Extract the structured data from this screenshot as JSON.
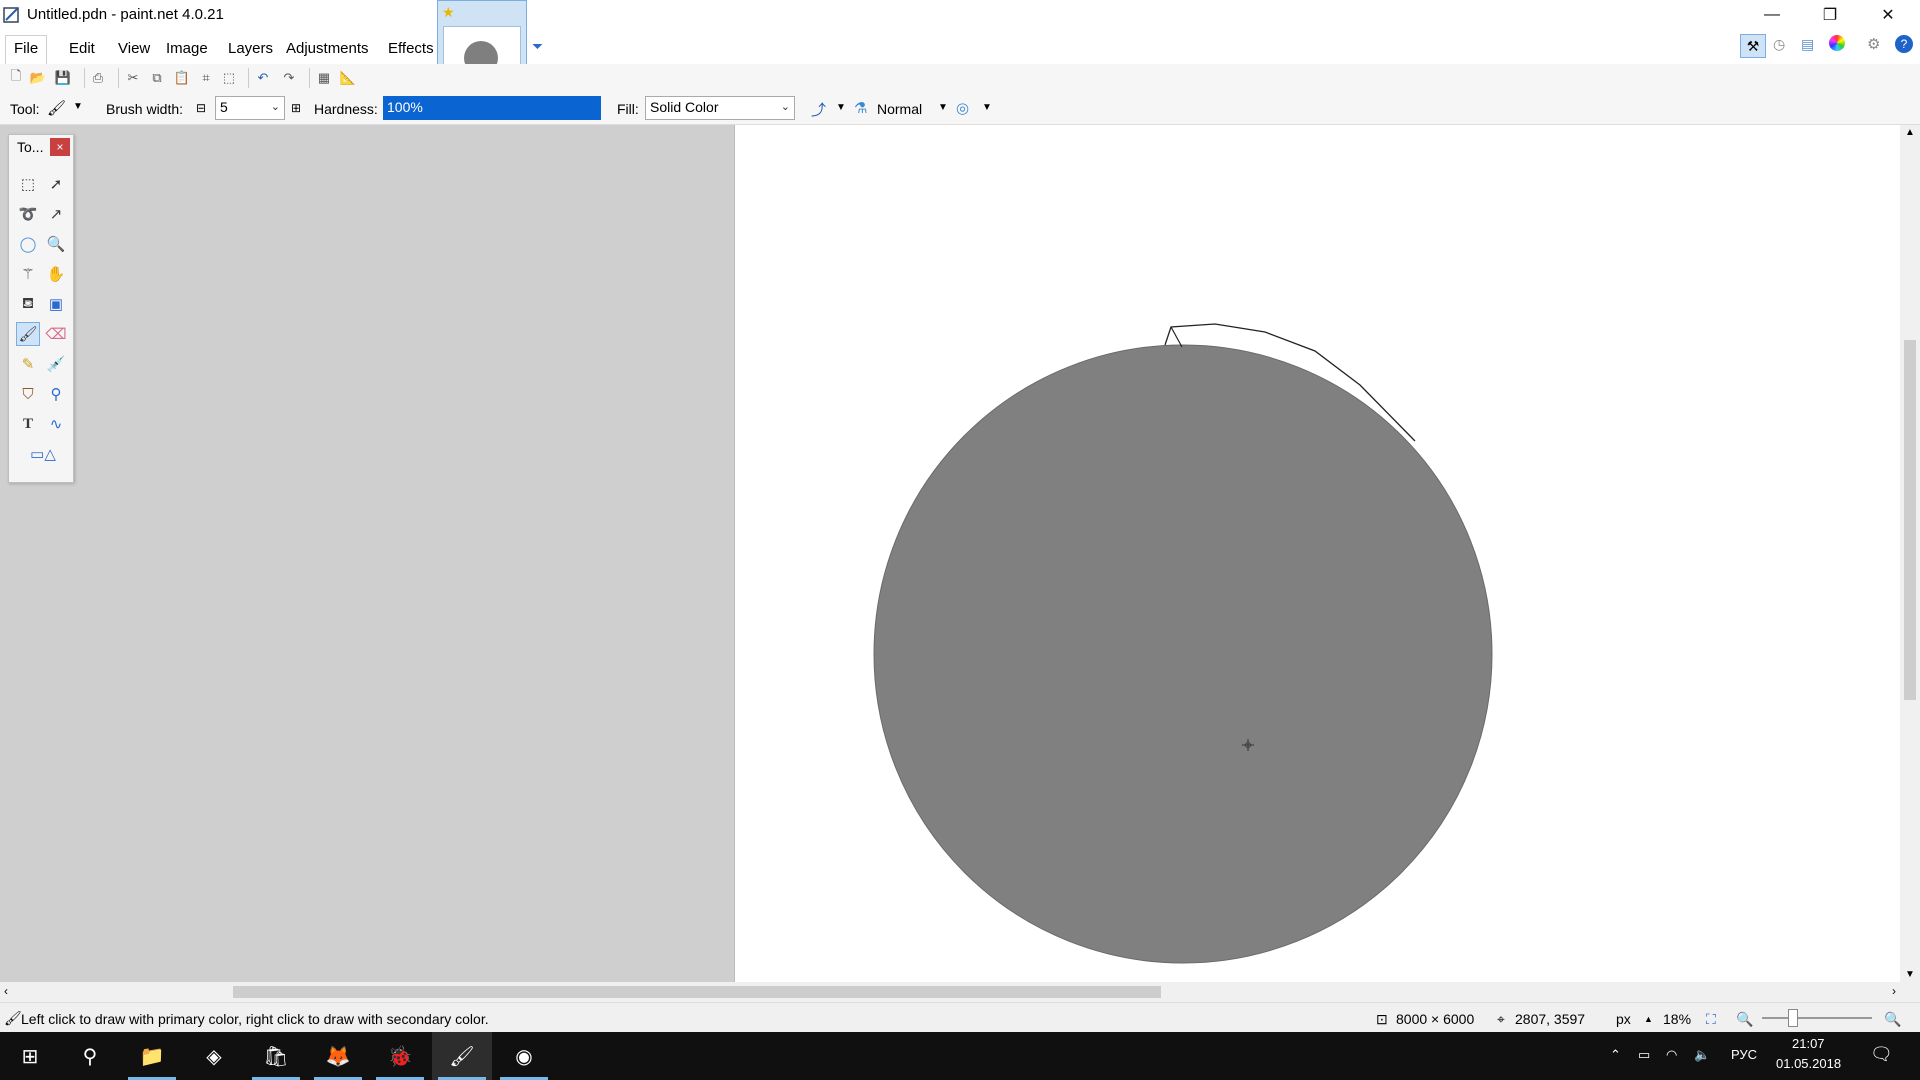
{
  "window": {
    "title": "Untitled.pdn - paint.net 4.0.21",
    "controls": {
      "minimize": "—",
      "maximize": "❐",
      "close": "✕"
    }
  },
  "menu": [
    "File",
    "Edit",
    "View",
    "Image",
    "Layers",
    "Adjustments",
    "Effects"
  ],
  "toolbar": {
    "tool_label": "Tool:",
    "brush_width_label": "Brush width:",
    "brush_width_value": "5",
    "hardness_label": "Hardness:",
    "hardness_value": "100%",
    "fill_label": "Fill:",
    "fill_value": "Solid Color",
    "blend_mode": "Normal"
  },
  "tools_panel": {
    "title": "To...",
    "close": "×",
    "selected_tool": "paintbrush",
    "tools": [
      "rectangle-select",
      "move-selection",
      "lasso-select",
      "move-selected",
      "ellipse-select",
      "zoom",
      "magic-wand",
      "pan",
      "paint-bucket",
      "gradient",
      "paintbrush",
      "eraser",
      "pencil",
      "color-picker",
      "clone-stamp",
      "recolor",
      "text",
      "line-curve",
      "shapes"
    ]
  },
  "canvas": {
    "circle_color": "#808080",
    "background_color": "#ffffff"
  },
  "status": {
    "hint": "Left click to draw with primary color, right click to draw with secondary color.",
    "image_size": "8000 × 6000",
    "cursor_pos": "2807, 3597",
    "unit": "px",
    "zoom": "18%"
  },
  "taskbar": {
    "lang": "РУС",
    "time": "21:07",
    "date": "01.05.2018"
  }
}
